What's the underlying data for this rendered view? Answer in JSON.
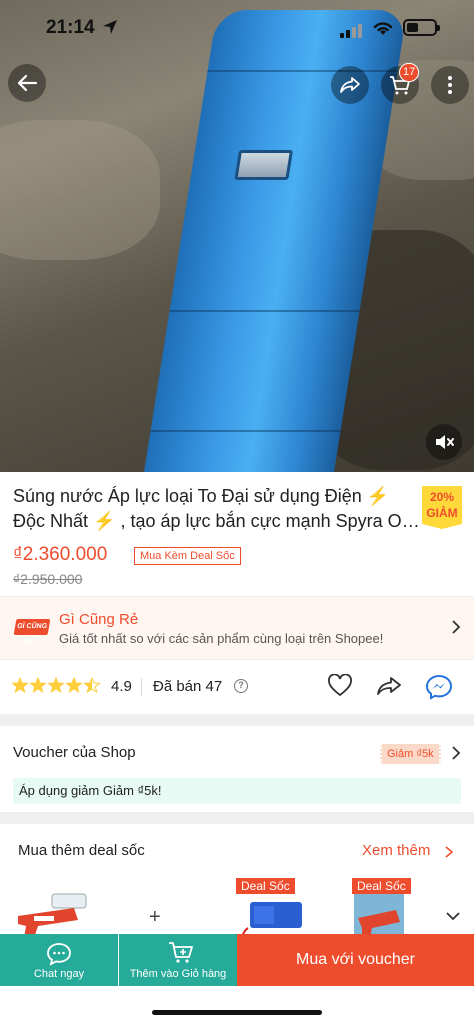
{
  "status_bar": {
    "time": "21:14"
  },
  "header": {
    "cart_count": "17"
  },
  "product": {
    "title": "Súng nước Áp lực loại To Đại sử dụng Điện ⚡️ Độc Nhất ⚡️ , tạo áp lực bắn cực mạnh Spyra One đẹp",
    "discount_line1": "20%",
    "discount_line2": "GIẢM",
    "price": "₫2.360.000",
    "original_price": "₫2.950.000",
    "deal_chip": "Mua Kèm Deal Sốc"
  },
  "cheap_banner": {
    "logo": "GÌ CŨNG RẺ",
    "title": "Gì Cũng Rẻ",
    "subtitle": "Giá tốt nhất so với các sản phẩm cùng loại trên Shopee!"
  },
  "rating": {
    "stars": 4.5,
    "value": "4.9",
    "sold": "Đã bán 47"
  },
  "voucher": {
    "title": "Voucher của Shop",
    "chip": "Giảm ₫5k",
    "applied": "Áp dụng giảm Giảm ₫5k!"
  },
  "deal_section": {
    "title": "Mua thêm deal sốc",
    "more": "Xem thêm",
    "badge": "Deal Sốc",
    "plus": "+"
  },
  "bottom_bar": {
    "chat": "Chat ngay",
    "add_cart": "Thêm vào Giỏ hàng",
    "buy": "Mua với voucher"
  },
  "colors": {
    "accent": "#ee4d2d",
    "teal": "#26aa99",
    "star": "#ffce3d"
  }
}
